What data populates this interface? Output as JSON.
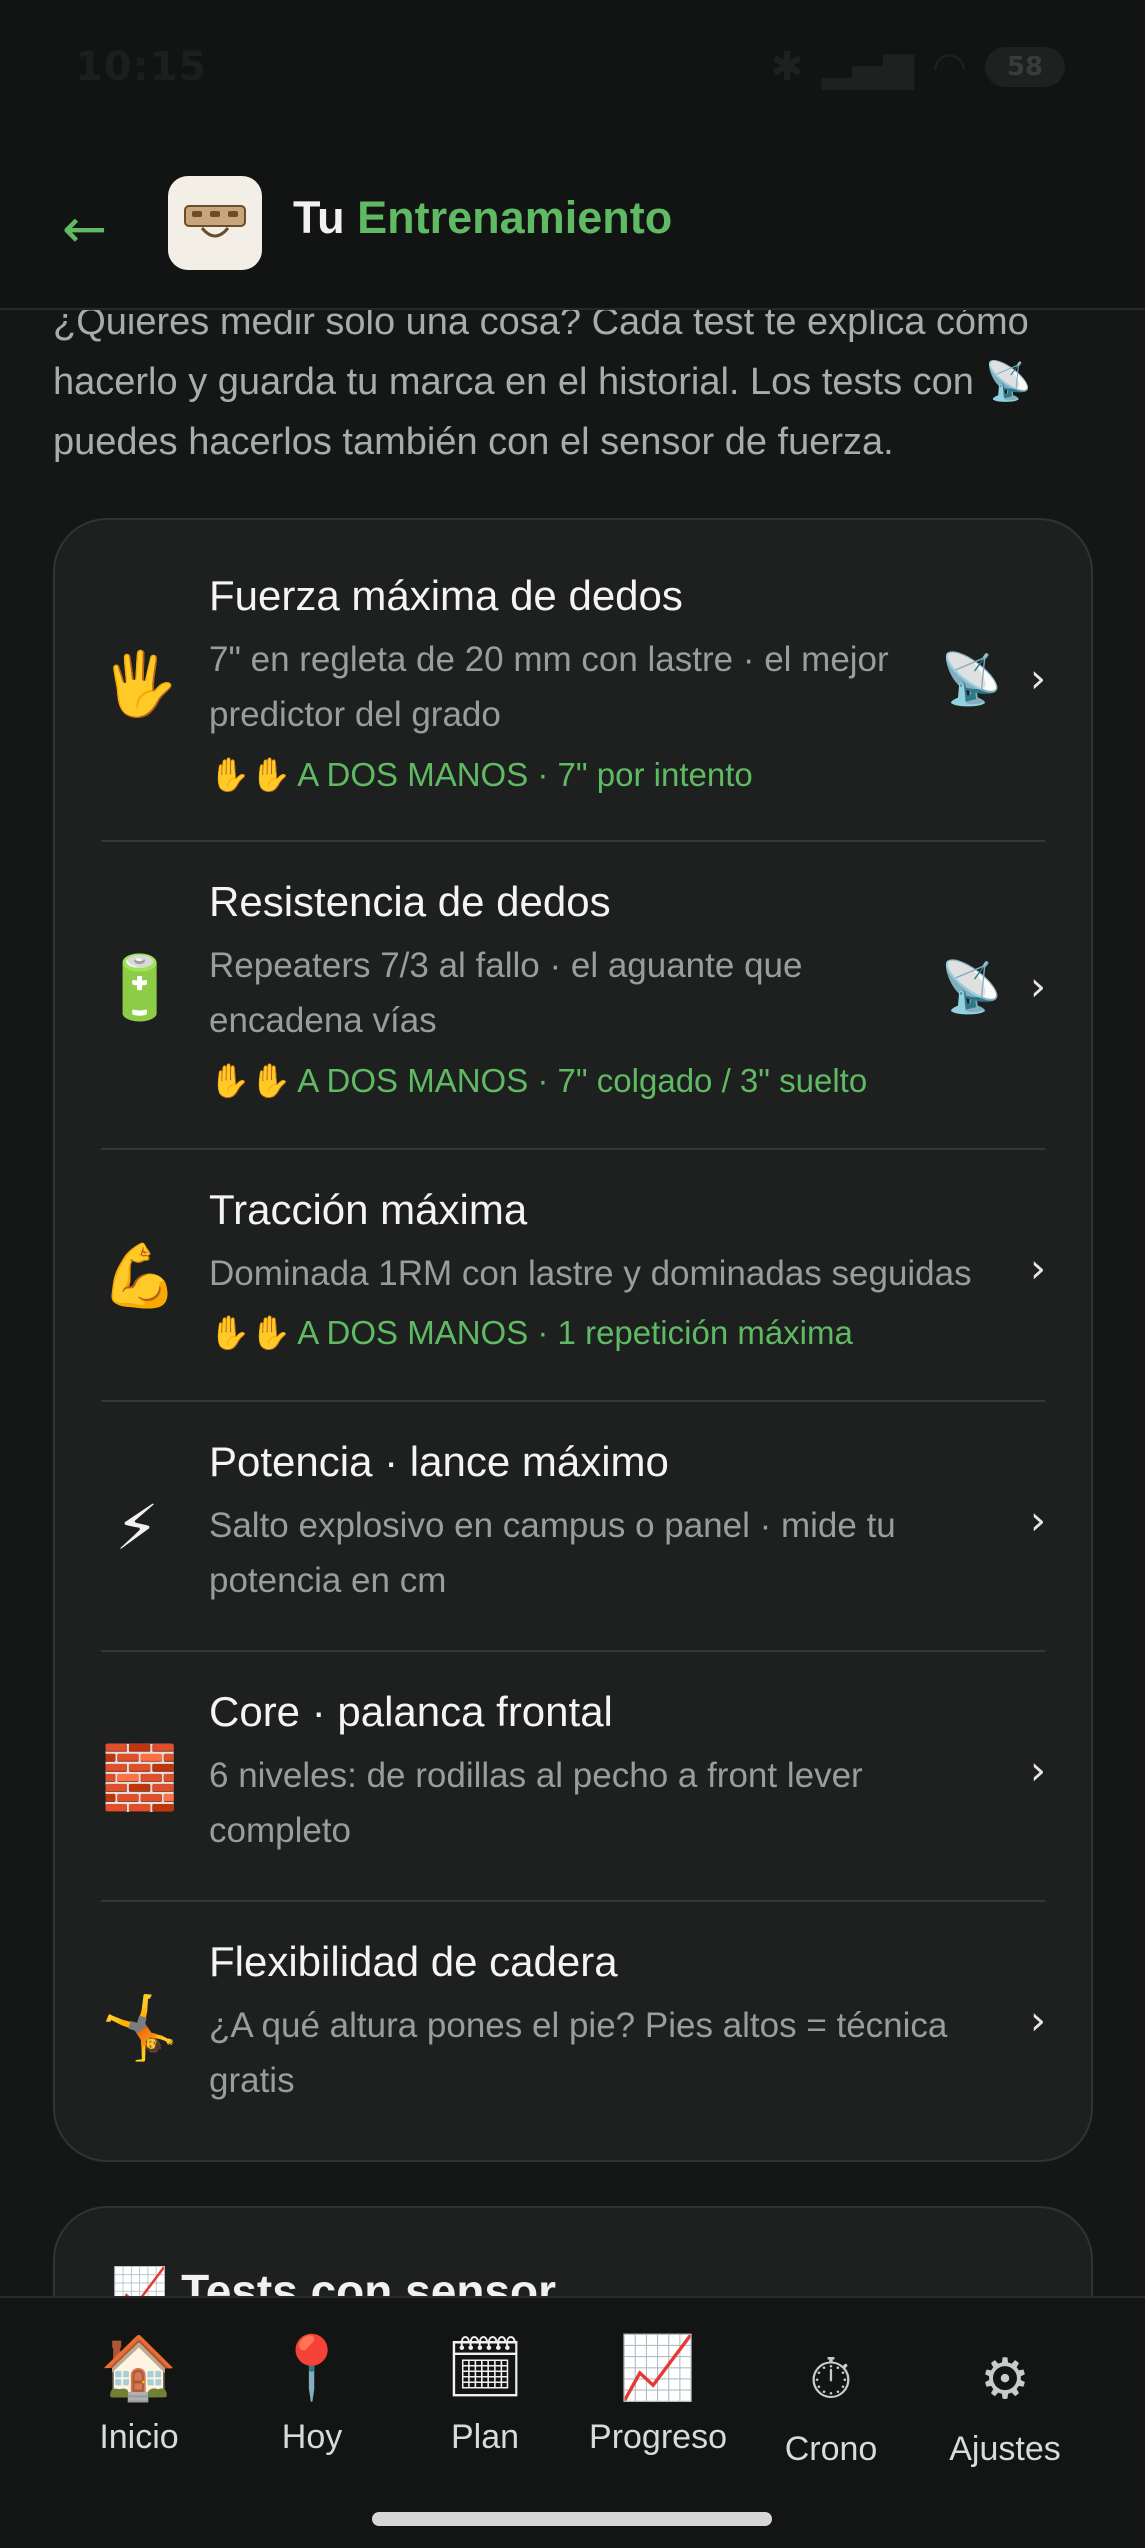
{
  "status_bar": {
    "time": "10:15",
    "battery": "58"
  },
  "header": {
    "back_icon": "arrow-left-icon",
    "title_part1": "Tu",
    "title_part2": "Entrenamiento",
    "accent_color": "#5fba63"
  },
  "intro": {
    "line1": "¿Quieres medir solo una cosa? Cada test te explica cómo",
    "line2": "hacerlo y guarda tu marca en el historial. Los tests con",
    "line2_icon": "📡",
    "line3": "puedes hacerlos también con el sensor de fuerza."
  },
  "tests": [
    {
      "emoji": "🖐",
      "title": "Fuerza máxima de dedos",
      "desc_line1": "7\" en regleta de 20 mm con lastre · el mejor",
      "desc_line2": "predictor del grado",
      "tag_hands": "✋✋",
      "tag": "A DOS MANOS · 7\" por intento",
      "sensor": "📡"
    },
    {
      "emoji": "🔋",
      "title": "Resistencia de dedos",
      "desc_line1": "Repeaters 7/3 al fallo · el aguante que",
      "desc_line2": "encadena vías",
      "tag_hands": "✋✋",
      "tag": "A DOS MANOS · 7\" colgado / 3\" suelto",
      "sensor": "📡"
    },
    {
      "emoji": "💪",
      "title": "Tracción máxima",
      "desc_line1": "Dominada 1RM con lastre y dominadas seguidas",
      "tag_hands": "✋✋",
      "tag": "A DOS MANOS · 1 repetición máxima"
    },
    {
      "emoji": "⚡",
      "title": "Potencia · lance máximo",
      "desc_line1": "Salto explosivo en campus o panel · mide tu",
      "desc_line2": "potencia en cm"
    },
    {
      "emoji": "🧱",
      "title": "Core · palanca frontal",
      "desc_line1": "6 niveles: de rodillas al pecho a front lever",
      "desc_line2": "completo"
    },
    {
      "emoji": "🤸",
      "title": "Flexibilidad de cadera",
      "desc_line1": "¿A qué altura pones el pie? Pies altos = técnica",
      "desc_line2": "gratis"
    }
  ],
  "chevron": "›",
  "next_card": {
    "icon": "📈",
    "title": "Tests con sensor"
  },
  "nav": [
    {
      "icon": "🏠",
      "label": "Inicio"
    },
    {
      "icon": "📍",
      "label": "Hoy"
    },
    {
      "icon": "🗓",
      "label": "Plan"
    },
    {
      "icon": "📈",
      "label": "Progreso"
    },
    {
      "icon": "⏱",
      "label": "Crono"
    },
    {
      "icon": "⚙",
      "label": "Ajustes"
    }
  ]
}
